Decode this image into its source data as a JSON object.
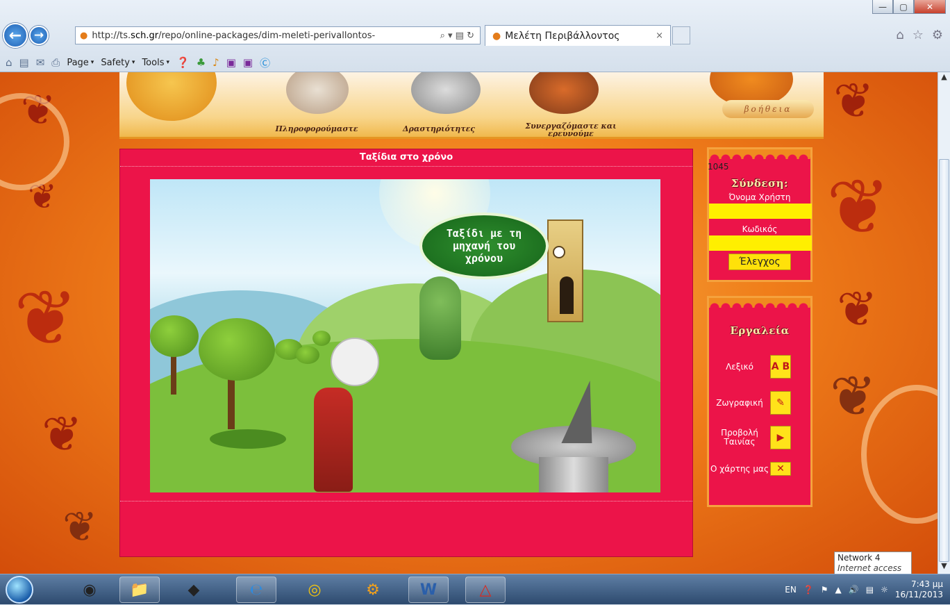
{
  "browser": {
    "url_prefix": "http://ts.",
    "url_domain": "sch.gr",
    "url_rest": "/repo/online-packages/dim-meleti-perivallontos-",
    "address_tools": "⌕ ▾ ▤ ↻",
    "tab_title": "Μελέτη Περιβάλλοντος",
    "tab_close": "×",
    "window_buttons": {
      "minimize": "—",
      "maximize": "▢",
      "close": "✕"
    },
    "right_icons": {
      "home": "⌂",
      "favorites": "☆",
      "settings": "⚙"
    },
    "command_bar": {
      "page": "Page",
      "safety": "Safety",
      "tools": "Tools",
      "caret": "▾"
    }
  },
  "site": {
    "nav": {
      "info": "Πληροφορούμαστε",
      "activities": "Δραστηριότητες",
      "collab_line1": "Συνεργαζόμαστε και",
      "collab_line2": "ερευνούμε"
    },
    "help": "βοήθεια",
    "main": {
      "title": "Ταξίδια στο χρόνο",
      "bubble_text": "Ταξίδι με τη μηχανή του χρόνου"
    },
    "login": {
      "counter": "1045",
      "heading": "Σύνδεση:",
      "username_label": "Όνομα Χρήστη",
      "password_label": "Κωδικός",
      "check_button": "Έλεγχος"
    },
    "tools": {
      "heading": "Εργαλεία",
      "items": [
        {
          "label": "Λεξικό",
          "icon": "dictionary-icon",
          "glyph": "A B"
        },
        {
          "label": "Ζωγραφική",
          "icon": "paint-icon",
          "glyph": "✎"
        },
        {
          "label": "Προβολή Ταινίας",
          "icon": "video-icon",
          "glyph": "▶"
        },
        {
          "label": "Ο χάρτης μας",
          "icon": "map-icon",
          "glyph": "✕"
        }
      ]
    }
  },
  "status": {
    "network_name": "Network 4",
    "network_status": "Internet access"
  },
  "taskbar": {
    "language": "EN",
    "time": "7:43 μμ",
    "date": "16/11/2013"
  },
  "colors": {
    "panel": "#ec1449",
    "input": "#ffef00",
    "accent_orange": "#f07e1a"
  }
}
